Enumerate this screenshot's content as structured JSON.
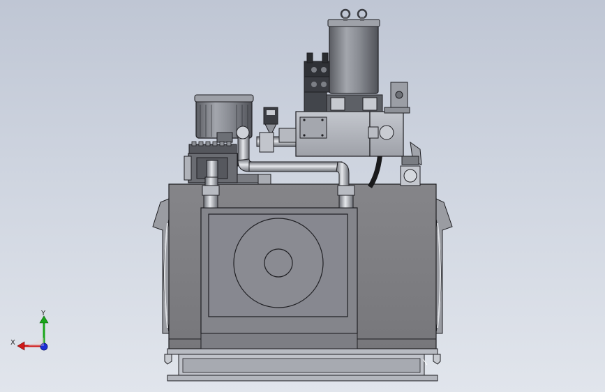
{
  "viewport": {
    "background_top": "#bfc6d4",
    "background_bottom": "#e1e5ec"
  },
  "model": {
    "body_color": "#7d7d80",
    "edge_color": "#1e1e22",
    "panel_color": "#8c8d93",
    "metal_light": "#c9ccd2",
    "metal_dark": "#4a4c52"
  },
  "triad": {
    "x_label": "X",
    "y_label": "Y",
    "x_color": "#d01818",
    "y_color": "#19a619",
    "z_color": "#1a2fd6"
  }
}
